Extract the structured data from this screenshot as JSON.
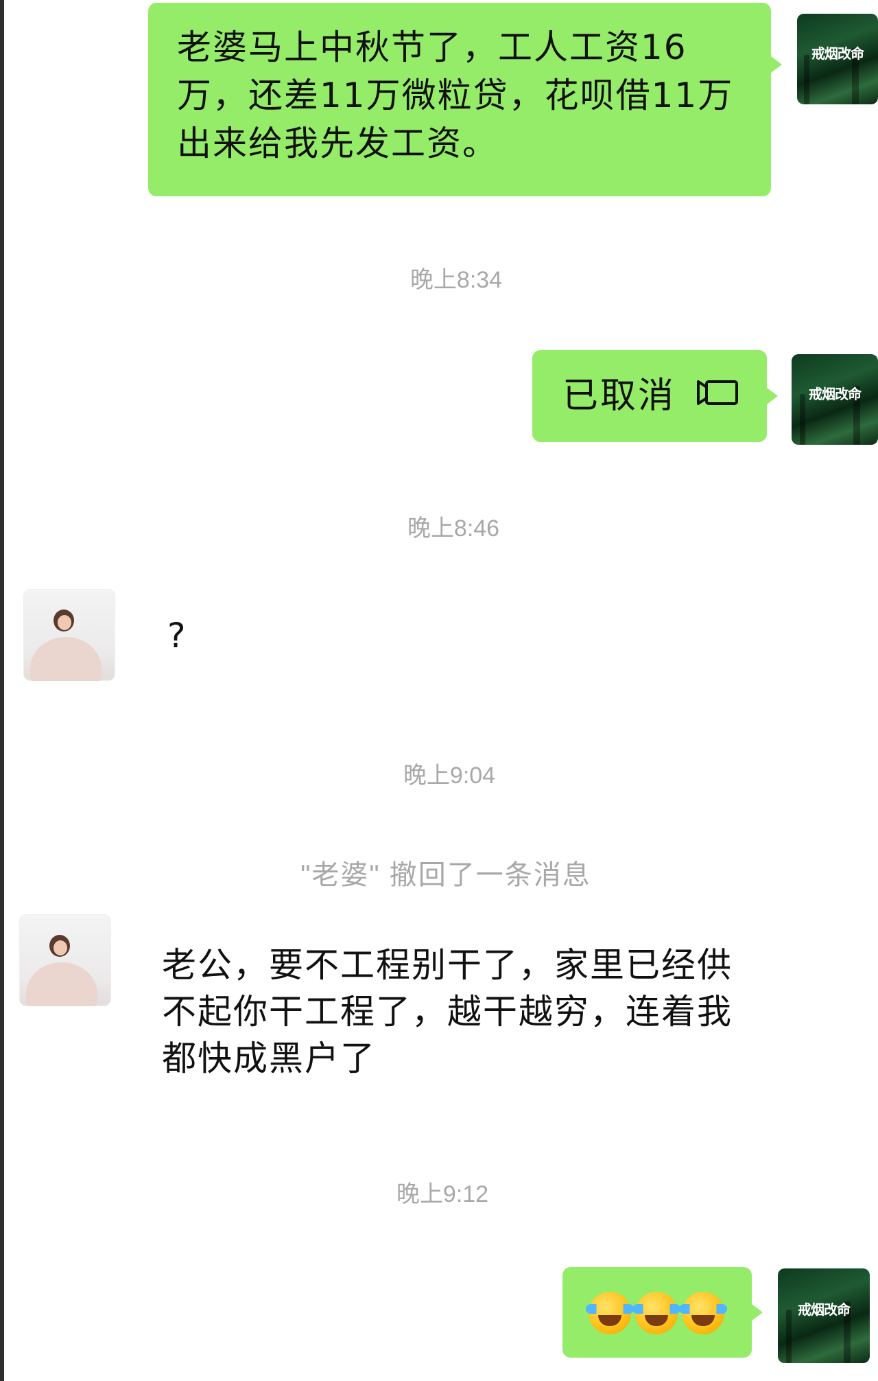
{
  "conversation": {
    "messages": [
      {
        "side": "me",
        "text": "老婆马上中秋节了，工人工资16万，还差11万微粒贷，花呗借11万出来给我先发工资。"
      },
      {
        "side": "me",
        "text": "已取消",
        "icon": "video-call-icon"
      },
      {
        "side": "her",
        "text": "?"
      },
      {
        "side": "her",
        "text": "老公，要不工程别干了，家里已经供不起你干工程了，越干越穷，连着我都快成黑户了"
      },
      {
        "side": "me",
        "emoji": [
          "joy-tears-emoji",
          "joy-tears-emoji",
          "joy-tears-emoji"
        ]
      }
    ],
    "timestamps": [
      "晚上8:34",
      "晚上8:46",
      "晚上9:04",
      "晚上9:12"
    ],
    "system_notice": "\"老婆\" 撤回了一条消息"
  },
  "avatars": {
    "me_label": "戒烟改命"
  },
  "colors": {
    "my_bubble": "#95ec69",
    "timestamp": "#a8a8a8",
    "background": "#ffffff"
  }
}
